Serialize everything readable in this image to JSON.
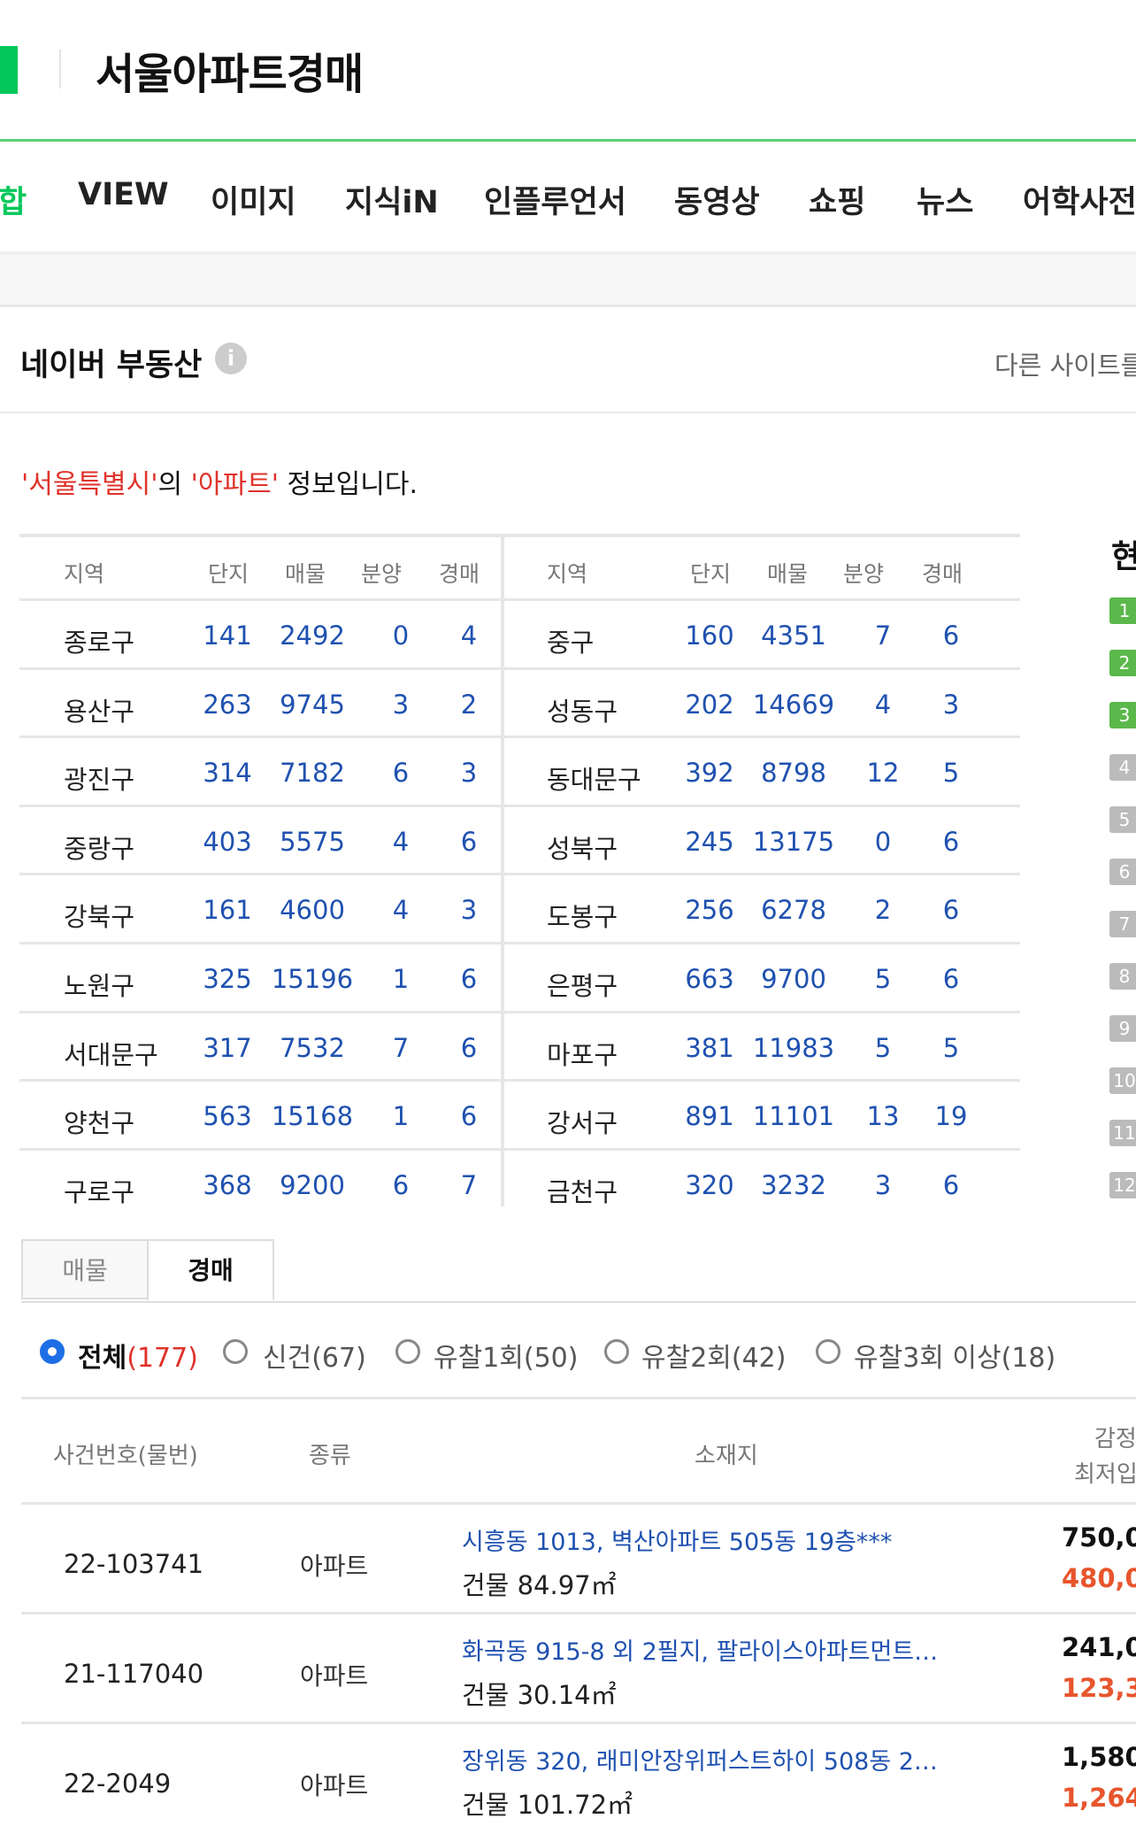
{
  "header": {
    "query": "서울아파트경매"
  },
  "tabs": [
    "합",
    "VIEW",
    "이미지",
    "지식iN",
    "인플루언서",
    "동영상",
    "쇼핑",
    "뉴스",
    "어학사전"
  ],
  "section": {
    "title": "네이버 부동산",
    "info_icon": "i",
    "other_site": "다른 사이트를"
  },
  "intro": {
    "q1": "'서울특별시'",
    "p1": "의 ",
    "q2": "'아파트'",
    "p2": " 정보입니다."
  },
  "region_table": {
    "headers": [
      "지역",
      "단지",
      "매물",
      "분양",
      "경매"
    ],
    "rows": [
      {
        "left": [
          "종로구",
          "141",
          "2492",
          "0",
          "4"
        ],
        "right": [
          "중구",
          "160",
          "4351",
          "7",
          "6"
        ]
      },
      {
        "left": [
          "용산구",
          "263",
          "9745",
          "3",
          "2"
        ],
        "right": [
          "성동구",
          "202",
          "14669",
          "4",
          "3"
        ]
      },
      {
        "left": [
          "광진구",
          "314",
          "7182",
          "6",
          "3"
        ],
        "right": [
          "동대문구",
          "392",
          "8798",
          "12",
          "5"
        ]
      },
      {
        "left": [
          "중랑구",
          "403",
          "5575",
          "4",
          "6"
        ],
        "right": [
          "성북구",
          "245",
          "13175",
          "0",
          "6"
        ]
      },
      {
        "left": [
          "강북구",
          "161",
          "4600",
          "4",
          "3"
        ],
        "right": [
          "도봉구",
          "256",
          "6278",
          "2",
          "6"
        ]
      },
      {
        "left": [
          "노원구",
          "325",
          "15196",
          "1",
          "6"
        ],
        "right": [
          "은평구",
          "663",
          "9700",
          "5",
          "6"
        ]
      },
      {
        "left": [
          "서대문구",
          "317",
          "7532",
          "7",
          "6"
        ],
        "right": [
          "마포구",
          "381",
          "11983",
          "5",
          "5"
        ]
      },
      {
        "left": [
          "양천구",
          "563",
          "15168",
          "1",
          "6"
        ],
        "right": [
          "강서구",
          "891",
          "11101",
          "13",
          "19"
        ]
      },
      {
        "left": [
          "구로구",
          "368",
          "9200",
          "6",
          "7"
        ],
        "right": [
          "금천구",
          "320",
          "3232",
          "3",
          "6"
        ]
      }
    ]
  },
  "rank": {
    "title": "현",
    "items": [
      "1",
      "2",
      "3",
      "4",
      "5",
      "6",
      "7",
      "8",
      "9",
      "10",
      "11",
      "12"
    ]
  },
  "subtabs": [
    "매물",
    "경매"
  ],
  "filters": [
    {
      "label": "전체",
      "count": "(177)",
      "selected": true
    },
    {
      "label": "신건(67)"
    },
    {
      "label": "유찰1회(50)"
    },
    {
      "label": "유찰2회(42)"
    },
    {
      "label": "유찰3회 이상(18)"
    }
  ],
  "auction_table": {
    "headers": {
      "case": "사건번호(물번)",
      "type": "종류",
      "address": "소재지",
      "price1": "감정",
      "price2": "최저입"
    },
    "rows": [
      {
        "case": "22-103741",
        "type": "아파트",
        "address": "시흥동 1013, 벽산아파트 505동 19층***",
        "area": "건물 84.97㎡",
        "price1": "750,0",
        "price2": "480,0"
      },
      {
        "case": "21-117040",
        "type": "아파트",
        "address": "화곡동 915-8 외 2필지, 팔라이스아파트먼트…",
        "area": "건물 30.14㎡",
        "price1": "241,0",
        "price2": "123,3"
      },
      {
        "case": "22-2049",
        "type": "아파트",
        "address": "장위동 320, 래미안장위퍼스트하이 508동 2…",
        "area": "건물 101.72㎡",
        "price1": "1,580,",
        "price2": "1,264,"
      }
    ]
  },
  "colors": {
    "brand": "#03c75a",
    "link": "#1f51b0",
    "accent_red": "#e0322b",
    "price_low": "#e8552d"
  }
}
